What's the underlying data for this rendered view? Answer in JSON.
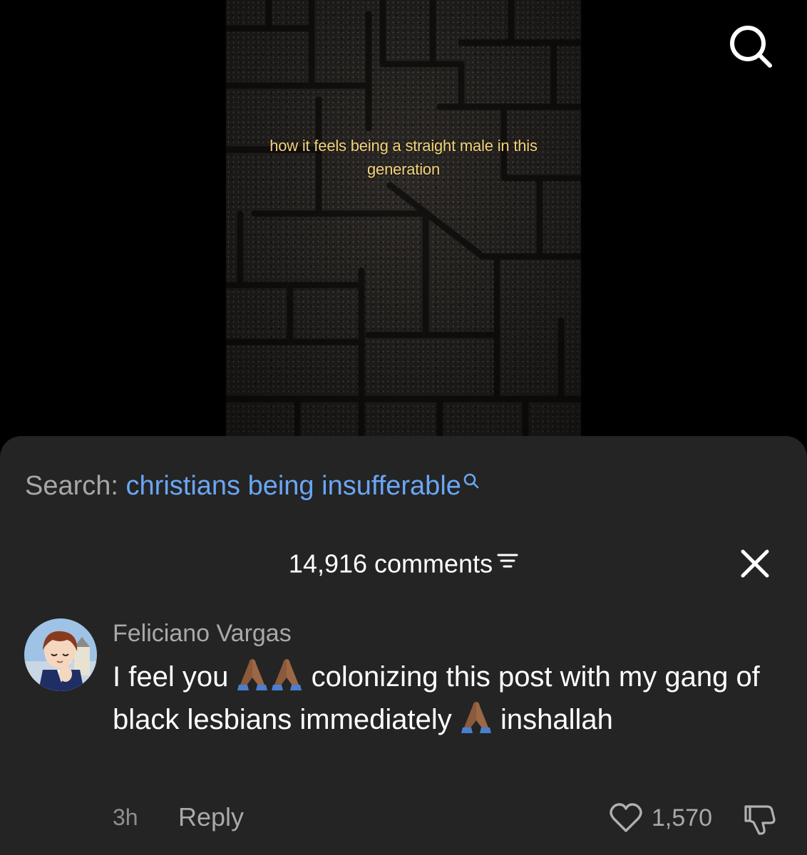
{
  "video": {
    "caption": "how it feels being a straight male in this generation"
  },
  "search_suggestion": {
    "prefix": "Search:",
    "query": "christians being insufferable"
  },
  "comments_panel": {
    "count_label": "14,916 comments"
  },
  "comment": {
    "author": "Feliciano Vargas",
    "text_part1": "I feel you",
    "text_part2": "colonizing this post with my gang of black lesbians immediately",
    "text_part3": "inshallah",
    "emoji": "folded-hands",
    "time": "3h",
    "reply_label": "Reply",
    "likes": "1,570"
  },
  "colors": {
    "sheet_background": "#242424",
    "search_query": "#6aa6f4",
    "caption": "#f3d27a",
    "secondary_text": "#a9a9a9"
  },
  "icons": [
    "search-icon",
    "filter-icon",
    "close-icon",
    "heart-icon",
    "dislike-icon",
    "folded-hands-emoji"
  ]
}
